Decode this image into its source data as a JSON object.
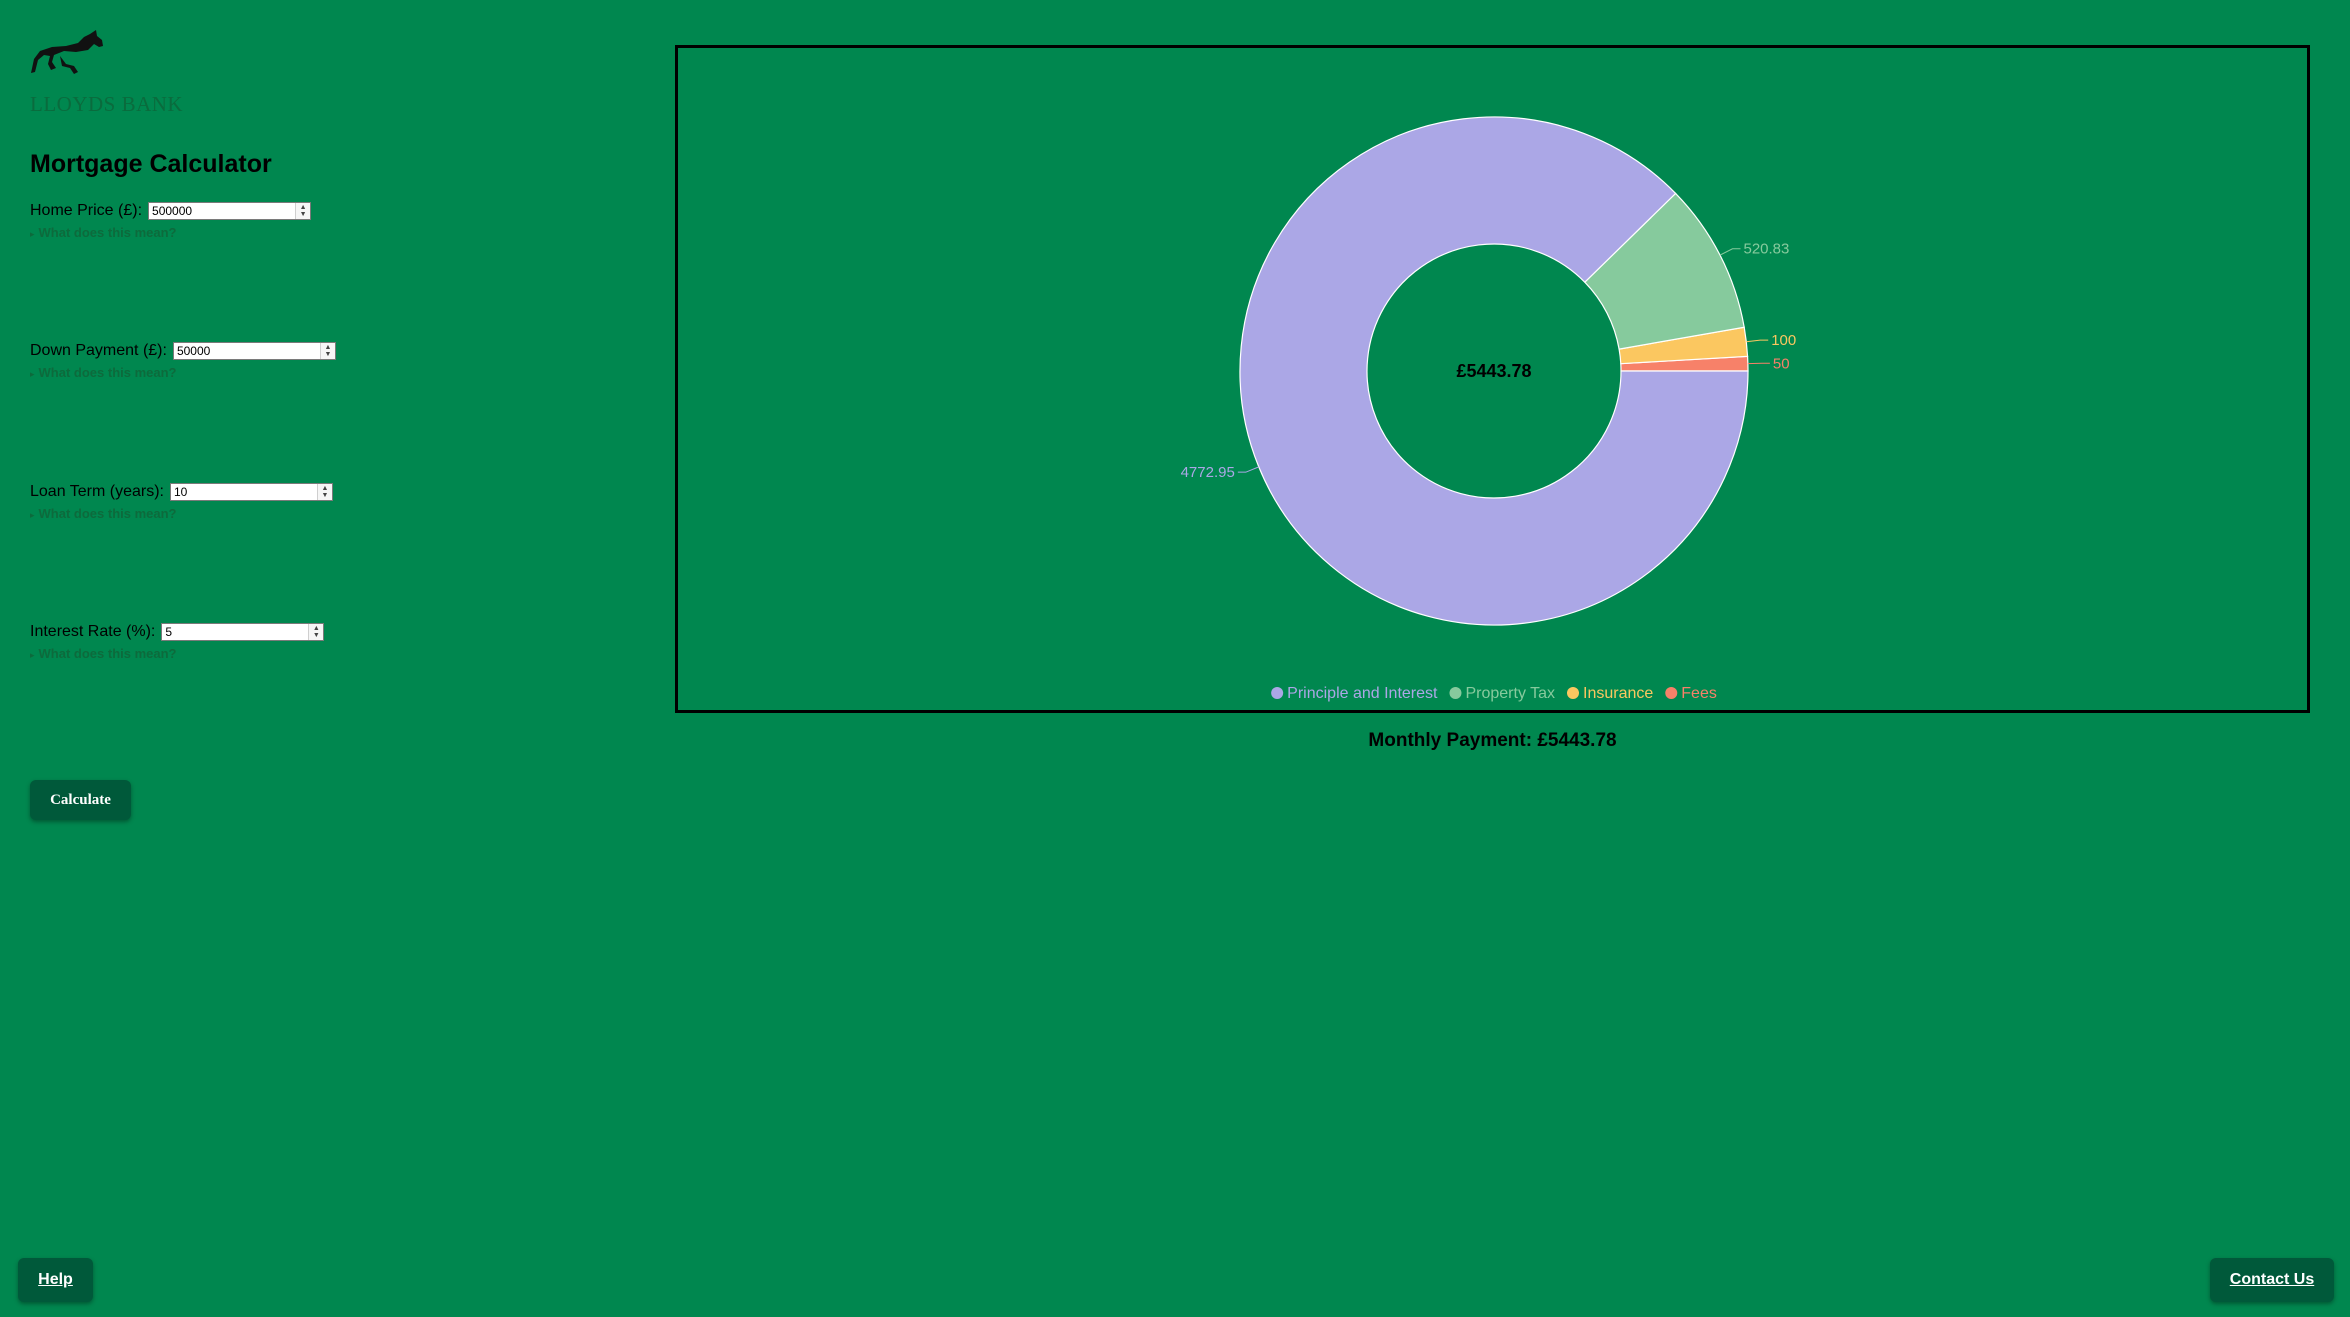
{
  "brand": {
    "name": "LLOYDS BANK",
    "logo_icon": "black-horse-icon"
  },
  "page_title": "Mortgage Calculator",
  "fields": [
    {
      "label": "Home Price (£):",
      "value": "500000",
      "help_label": "What does this mean?"
    },
    {
      "label": "Down Payment (£):",
      "value": "50000",
      "help_label": "What does this mean?"
    },
    {
      "label": "Loan Term (years):",
      "value": "10",
      "help_label": "What does this mean?"
    },
    {
      "label": "Interest Rate (%):",
      "value": "5",
      "help_label": "What does this mean?"
    }
  ],
  "calculate_label": "Calculate",
  "help_label": "Help",
  "contact_label": "Contact Us",
  "monthly_payment": "Monthly Payment: £5443.78",
  "colors": {
    "background": "#00874f",
    "button": "#00593a",
    "principle": "#aba7e6",
    "tax": "#86ca9d",
    "insurance": "#fbc760",
    "fees": "#f78169"
  },
  "chart_data": {
    "type": "pie",
    "subtype": "donut",
    "center_label": "£5443.78",
    "categories": [
      "Principle and Interest",
      "Property Tax",
      "Insurance",
      "Fees"
    ],
    "values": [
      4772.95,
      520.83,
      100,
      50
    ],
    "value_labels": [
      "4772.95",
      "520.83",
      "100",
      "50"
    ],
    "colors": [
      "#aba7e6",
      "#86ca9d",
      "#fbc760",
      "#f78169"
    ],
    "legend_position": "bottom"
  }
}
